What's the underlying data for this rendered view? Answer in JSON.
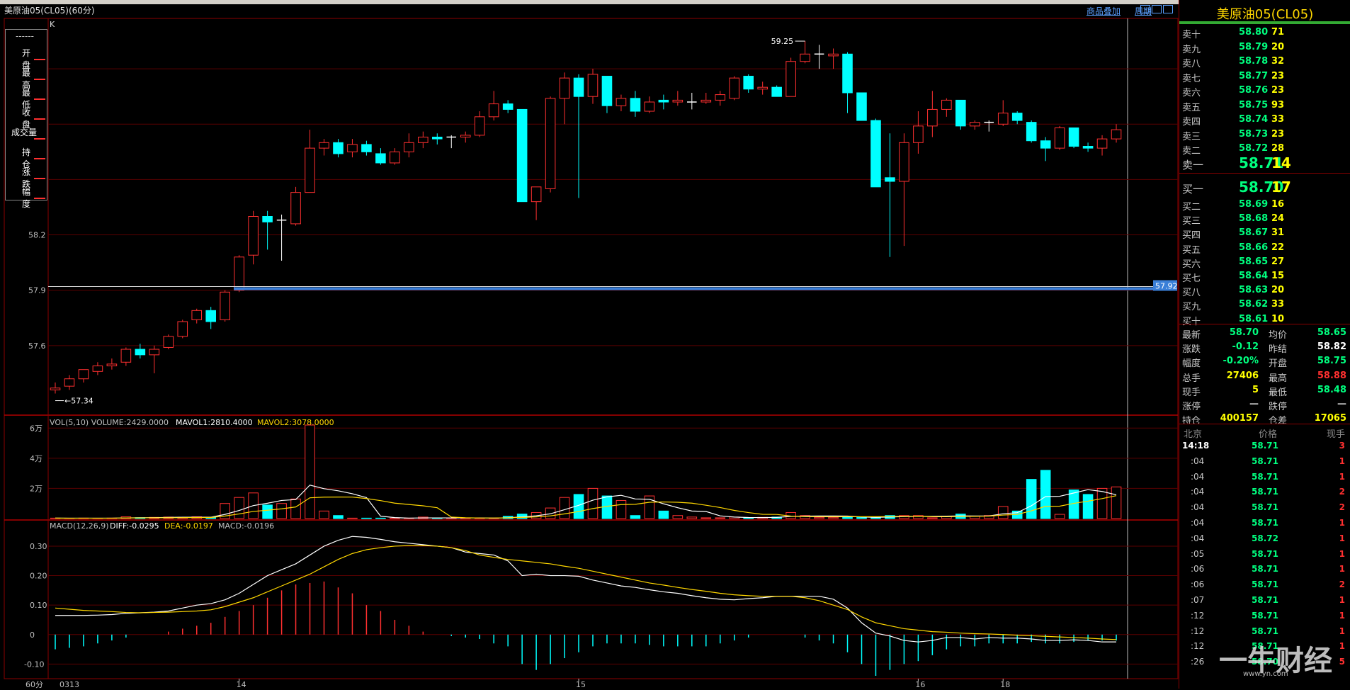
{
  "window": {
    "title": "美原油05(CL05)(60分)",
    "links": [
      "商品叠加",
      "周期"
    ]
  },
  "legend": {
    "header": "------",
    "items": [
      "开 盘",
      "最 高",
      "最 低",
      "收 盘",
      "成交量",
      "持 仓",
      "涨 跌",
      "幅 度"
    ]
  },
  "chart_data": {
    "type": "candlestick",
    "timeframe": "60分",
    "corner_label": "K",
    "price_axis": {
      "ticks": [
        58.2,
        57.9,
        57.6
      ],
      "labels": [
        "58.2",
        "57.9",
        "57.6"
      ],
      "ylim": [
        57.25,
        59.35
      ]
    },
    "high_marker": "59.25",
    "low_marker": "57.34",
    "crosshair_price": "57.92",
    "date_labels": [
      "0313",
      "14",
      "15",
      "16",
      "18"
    ],
    "candles": [
      {
        "o": 57.36,
        "h": 57.4,
        "l": 57.34,
        "c": 57.37
      },
      {
        "o": 57.38,
        "h": 57.44,
        "l": 57.36,
        "c": 57.42
      },
      {
        "o": 57.42,
        "h": 57.47,
        "l": 57.4,
        "c": 57.47
      },
      {
        "o": 57.46,
        "h": 57.51,
        "l": 57.44,
        "c": 57.49
      },
      {
        "o": 57.49,
        "h": 57.53,
        "l": 57.47,
        "c": 57.5
      },
      {
        "o": 57.51,
        "h": 57.59,
        "l": 57.49,
        "c": 57.58
      },
      {
        "o": 57.58,
        "h": 57.61,
        "l": 57.53,
        "c": 57.55
      },
      {
        "o": 57.55,
        "h": 57.6,
        "l": 57.45,
        "c": 57.58
      },
      {
        "o": 57.59,
        "h": 57.66,
        "l": 57.58,
        "c": 57.65
      },
      {
        "o": 57.65,
        "h": 57.74,
        "l": 57.64,
        "c": 57.73
      },
      {
        "o": 57.74,
        "h": 57.8,
        "l": 57.72,
        "c": 57.79
      },
      {
        "o": 57.79,
        "h": 57.81,
        "l": 57.69,
        "c": 57.73
      },
      {
        "o": 57.74,
        "h": 57.9,
        "l": 57.73,
        "c": 57.89
      },
      {
        "o": 57.9,
        "h": 58.09,
        "l": 57.89,
        "c": 58.08
      },
      {
        "o": 58.09,
        "h": 58.33,
        "l": 58.04,
        "c": 58.3
      },
      {
        "o": 58.3,
        "h": 58.33,
        "l": 58.12,
        "c": 58.27
      },
      {
        "o": 58.28,
        "h": 58.31,
        "l": 58.06,
        "c": 58.28
      },
      {
        "o": 58.26,
        "h": 58.46,
        "l": 58.25,
        "c": 58.43
      },
      {
        "o": 58.43,
        "h": 58.77,
        "l": 58.43,
        "c": 58.67
      },
      {
        "o": 58.67,
        "h": 58.72,
        "l": 58.63,
        "c": 58.7
      },
      {
        "o": 58.7,
        "h": 58.72,
        "l": 58.62,
        "c": 58.64
      },
      {
        "o": 58.65,
        "h": 58.72,
        "l": 58.62,
        "c": 58.69
      },
      {
        "o": 58.69,
        "h": 58.71,
        "l": 58.63,
        "c": 58.65
      },
      {
        "o": 58.64,
        "h": 58.67,
        "l": 58.58,
        "c": 58.59
      },
      {
        "o": 58.59,
        "h": 58.67,
        "l": 58.58,
        "c": 58.65
      },
      {
        "o": 58.65,
        "h": 58.75,
        "l": 58.62,
        "c": 58.7
      },
      {
        "o": 58.7,
        "h": 58.76,
        "l": 58.67,
        "c": 58.73
      },
      {
        "o": 58.73,
        "h": 58.75,
        "l": 58.69,
        "c": 58.72
      },
      {
        "o": 58.73,
        "h": 58.74,
        "l": 58.67,
        "c": 58.73
      },
      {
        "o": 58.73,
        "h": 58.76,
        "l": 58.7,
        "c": 58.74
      },
      {
        "o": 58.74,
        "h": 58.87,
        "l": 58.73,
        "c": 58.84
      },
      {
        "o": 58.84,
        "h": 58.98,
        "l": 58.82,
        "c": 58.91
      },
      {
        "o": 58.91,
        "h": 58.93,
        "l": 58.86,
        "c": 58.88
      },
      {
        "o": 58.88,
        "h": 58.88,
        "l": 58.38,
        "c": 58.38
      },
      {
        "o": 58.38,
        "h": 58.44,
        "l": 58.28,
        "c": 58.46
      },
      {
        "o": 58.45,
        "h": 58.95,
        "l": 58.43,
        "c": 58.94
      },
      {
        "o": 58.94,
        "h": 59.08,
        "l": 58.8,
        "c": 59.05
      },
      {
        "o": 59.05,
        "h": 59.07,
        "l": 58.4,
        "c": 58.95
      },
      {
        "o": 58.95,
        "h": 59.1,
        "l": 58.91,
        "c": 59.07
      },
      {
        "o": 59.06,
        "h": 59.06,
        "l": 58.86,
        "c": 58.9
      },
      {
        "o": 58.9,
        "h": 58.96,
        "l": 58.87,
        "c": 58.94
      },
      {
        "o": 58.94,
        "h": 58.98,
        "l": 58.84,
        "c": 58.87
      },
      {
        "o": 58.87,
        "h": 58.95,
        "l": 58.86,
        "c": 58.92
      },
      {
        "o": 58.93,
        "h": 58.96,
        "l": 58.88,
        "c": 58.92
      },
      {
        "o": 58.92,
        "h": 58.98,
        "l": 58.9,
        "c": 58.93
      },
      {
        "o": 58.92,
        "h": 58.97,
        "l": 58.88,
        "c": 58.92
      },
      {
        "o": 58.92,
        "h": 58.97,
        "l": 58.91,
        "c": 58.93
      },
      {
        "o": 58.93,
        "h": 58.98,
        "l": 58.9,
        "c": 58.96
      },
      {
        "o": 58.94,
        "h": 59.06,
        "l": 58.93,
        "c": 59.05
      },
      {
        "o": 59.06,
        "h": 59.07,
        "l": 58.97,
        "c": 58.99
      },
      {
        "o": 58.99,
        "h": 59.03,
        "l": 58.96,
        "c": 59.0
      },
      {
        "o": 59.0,
        "h": 59.01,
        "l": 58.95,
        "c": 58.95
      },
      {
        "o": 58.95,
        "h": 59.16,
        "l": 58.95,
        "c": 59.14
      },
      {
        "o": 59.14,
        "h": 59.25,
        "l": 59.13,
        "c": 59.18
      },
      {
        "o": 59.18,
        "h": 59.23,
        "l": 59.1,
        "c": 59.18
      },
      {
        "o": 59.17,
        "h": 59.21,
        "l": 59.1,
        "c": 59.18
      },
      {
        "o": 59.18,
        "h": 59.19,
        "l": 58.86,
        "c": 58.97
      },
      {
        "o": 58.97,
        "h": 58.97,
        "l": 58.82,
        "c": 58.82
      },
      {
        "o": 58.82,
        "h": 58.83,
        "l": 58.46,
        "c": 58.46
      },
      {
        "o": 58.51,
        "h": 58.75,
        "l": 58.08,
        "c": 58.49
      },
      {
        "o": 58.49,
        "h": 58.75,
        "l": 58.14,
        "c": 58.7
      },
      {
        "o": 58.7,
        "h": 58.87,
        "l": 58.64,
        "c": 58.79
      },
      {
        "o": 58.79,
        "h": 58.98,
        "l": 58.73,
        "c": 58.88
      },
      {
        "o": 58.88,
        "h": 58.94,
        "l": 58.84,
        "c": 58.93
      },
      {
        "o": 58.93,
        "h": 58.93,
        "l": 58.77,
        "c": 58.79
      },
      {
        "o": 58.79,
        "h": 58.82,
        "l": 58.77,
        "c": 58.81
      },
      {
        "o": 58.81,
        "h": 58.82,
        "l": 58.76,
        "c": 58.81
      },
      {
        "o": 58.8,
        "h": 58.93,
        "l": 58.79,
        "c": 58.86
      },
      {
        "o": 58.86,
        "h": 58.87,
        "l": 58.8,
        "c": 58.82
      },
      {
        "o": 58.81,
        "h": 58.82,
        "l": 58.7,
        "c": 58.71
      },
      {
        "o": 58.71,
        "h": 58.73,
        "l": 58.6,
        "c": 58.67
      },
      {
        "o": 58.67,
        "h": 58.79,
        "l": 58.66,
        "c": 58.78
      },
      {
        "o": 58.78,
        "h": 58.78,
        "l": 58.67,
        "c": 58.68
      },
      {
        "o": 58.68,
        "h": 58.7,
        "l": 58.65,
        "c": 58.67
      },
      {
        "o": 58.67,
        "h": 58.74,
        "l": 58.63,
        "c": 58.72
      },
      {
        "o": 58.72,
        "h": 58.8,
        "l": 58.7,
        "c": 58.77
      }
    ],
    "volume": {
      "label": "VOL(5,10) VOLUME:2429.0000",
      "mavol1_label": "MAVOL1:2810.4000",
      "mavol2_label": "MAVOL2:3078.0000",
      "axis_labels": [
        "6万",
        "4万",
        "2万"
      ],
      "ylim": [
        0,
        62000
      ],
      "values": [
        300,
        200,
        300,
        200,
        300,
        1200,
        600,
        800,
        1000,
        800,
        1200,
        800,
        10000,
        14000,
        17000,
        9000,
        10000,
        13000,
        62000,
        5000,
        2000,
        300,
        300,
        300,
        300,
        300,
        1000,
        300,
        300,
        300,
        300,
        300,
        1500,
        3000,
        4000,
        7000,
        14000,
        16000,
        20000,
        15000,
        12000,
        2000,
        15000,
        5000,
        2000,
        1000,
        500,
        500,
        1000,
        500,
        800,
        1000,
        4000,
        2000,
        800,
        800,
        800,
        800,
        800,
        2000,
        2000,
        2000,
        500,
        1500,
        3000,
        1500,
        2000,
        8000,
        5000,
        26000,
        32000,
        2800,
        19000,
        16000,
        20000,
        21000,
        2500,
        2000,
        700,
        2000,
        1200,
        1500,
        2000,
        2000,
        1500,
        1100,
        1800
      ]
    },
    "macd": {
      "label": "MACD(12,26,9)",
      "diff_label": "DIFF:-0.0295",
      "dea_label": "DEA:-0.0197",
      "macd_label": "MACD:-0.0196",
      "axis_labels": [
        "0.30",
        "0.20",
        "0.10",
        "0",
        "-0.10"
      ],
      "ylim": [
        -0.14,
        0.36
      ],
      "diff": [
        0.065,
        0.065,
        0.065,
        0.066,
        0.068,
        0.072,
        0.074,
        0.076,
        0.08,
        0.09,
        0.1,
        0.105,
        0.118,
        0.14,
        0.17,
        0.2,
        0.22,
        0.24,
        0.27,
        0.3,
        0.32,
        0.333,
        0.33,
        0.323,
        0.315,
        0.31,
        0.305,
        0.3,
        0.295,
        0.28,
        0.275,
        0.27,
        0.25,
        0.2,
        0.205,
        0.2,
        0.2,
        0.198,
        0.185,
        0.175,
        0.165,
        0.16,
        0.152,
        0.145,
        0.14,
        0.132,
        0.125,
        0.12,
        0.118,
        0.122,
        0.125,
        0.13,
        0.13,
        0.13,
        0.13,
        0.12,
        0.09,
        0.04,
        0.005,
        -0.005,
        -0.02,
        -0.025,
        -0.02,
        -0.01,
        -0.01,
        -0.015,
        -0.01,
        -0.012,
        -0.012,
        -0.015,
        -0.02,
        -0.02,
        -0.018,
        -0.02,
        -0.025,
        -0.025,
        -0.03,
        -0.03
      ],
      "dea": [
        0.09,
        0.086,
        0.082,
        0.08,
        0.078,
        0.075,
        0.074,
        0.075,
        0.076,
        0.078,
        0.08,
        0.084,
        0.095,
        0.11,
        0.125,
        0.145,
        0.165,
        0.185,
        0.205,
        0.23,
        0.255,
        0.275,
        0.288,
        0.295,
        0.3,
        0.302,
        0.302,
        0.3,
        0.295,
        0.285,
        0.27,
        0.262,
        0.255,
        0.25,
        0.245,
        0.24,
        0.232,
        0.225,
        0.215,
        0.205,
        0.195,
        0.185,
        0.175,
        0.168,
        0.16,
        0.153,
        0.147,
        0.14,
        0.135,
        0.132,
        0.13,
        0.13,
        0.13,
        0.125,
        0.115,
        0.1,
        0.085,
        0.06,
        0.04,
        0.03,
        0.02,
        0.015,
        0.01,
        0.008,
        0.005,
        0.003,
        0.002,
        0.0,
        -0.002,
        -0.004,
        -0.006,
        -0.008,
        -0.01,
        -0.012,
        -0.015,
        -0.017,
        -0.019,
        -0.02
      ],
      "bars": [
        -0.05,
        -0.045,
        -0.04,
        -0.03,
        -0.02,
        -0.01,
        0.0,
        0.0,
        0.01,
        0.02,
        0.03,
        0.04,
        0.06,
        0.08,
        0.1,
        0.125,
        0.15,
        0.17,
        0.175,
        0.18,
        0.16,
        0.14,
        0.1,
        0.08,
        0.05,
        0.03,
        0.01,
        0.0,
        -0.005,
        -0.01,
        -0.015,
        -0.03,
        -0.04,
        -0.1,
        -0.12,
        -0.1,
        -0.08,
        -0.06,
        -0.04,
        -0.03,
        -0.03,
        -0.03,
        -0.035,
        -0.04,
        -0.04,
        -0.04,
        -0.04,
        -0.03,
        -0.02,
        -0.01,
        0.0,
        0.0,
        0.0,
        -0.01,
        -0.02,
        -0.03,
        -0.06,
        -0.1,
        -0.14,
        -0.12,
        -0.1,
        -0.09,
        -0.07,
        -0.05,
        -0.04,
        -0.04,
        -0.03,
        -0.03,
        -0.03,
        -0.025,
        -0.03,
        -0.03,
        -0.025,
        -0.02,
        -0.02,
        -0.02,
        -0.02,
        -0.02
      ]
    }
  },
  "panel": {
    "title": "美原油05(CL05)",
    "asks": [
      {
        "label": "卖十",
        "price": "58.80",
        "vol": "71"
      },
      {
        "label": "卖九",
        "price": "58.79",
        "vol": "20"
      },
      {
        "label": "卖八",
        "price": "58.78",
        "vol": "32"
      },
      {
        "label": "卖七",
        "price": "58.77",
        "vol": "23"
      },
      {
        "label": "卖六",
        "price": "58.76",
        "vol": "23"
      },
      {
        "label": "卖五",
        "price": "58.75",
        "vol": "93"
      },
      {
        "label": "卖四",
        "price": "58.74",
        "vol": "33"
      },
      {
        "label": "卖三",
        "price": "58.73",
        "vol": "23"
      },
      {
        "label": "卖二",
        "price": "58.72",
        "vol": "28"
      },
      {
        "label": "卖一",
        "price": "58.71",
        "vol": "14"
      }
    ],
    "bids": [
      {
        "label": "买一",
        "price": "58.70",
        "vol": "17"
      },
      {
        "label": "买二",
        "price": "58.69",
        "vol": "16"
      },
      {
        "label": "买三",
        "price": "58.68",
        "vol": "24"
      },
      {
        "label": "买四",
        "price": "58.67",
        "vol": "31"
      },
      {
        "label": "买五",
        "price": "58.66",
        "vol": "22"
      },
      {
        "label": "买六",
        "price": "58.65",
        "vol": "27"
      },
      {
        "label": "买七",
        "price": "58.64",
        "vol": "15"
      },
      {
        "label": "买八",
        "price": "58.63",
        "vol": "20"
      },
      {
        "label": "买九",
        "price": "58.62",
        "vol": "33"
      },
      {
        "label": "买十",
        "price": "58.61",
        "vol": "10"
      }
    ],
    "stats": [
      {
        "l1": "最新",
        "v1": "58.70",
        "c1": "#00ff7f",
        "l2": "均价",
        "v2": "58.65",
        "c2": "#00ff7f"
      },
      {
        "l1": "涨跌",
        "v1": "-0.12",
        "c1": "#00ff7f",
        "l2": "昨结",
        "v2": "58.82",
        "c2": "#ffffff"
      },
      {
        "l1": "幅度",
        "v1": "-0.20%",
        "c1": "#00ff7f",
        "l2": "开盘",
        "v2": "58.75",
        "c2": "#00ff7f"
      },
      {
        "l1": "总手",
        "v1": "27406",
        "c1": "#ffff00",
        "l2": "最高",
        "v2": "58.88",
        "c2": "#ff3030"
      },
      {
        "l1": "现手",
        "v1": "5",
        "c1": "#ffff00",
        "l2": "最低",
        "v2": "58.48",
        "c2": "#00ff7f"
      },
      {
        "l1": "涨停",
        "v1": "—",
        "c1": "#c8c8c8",
        "l2": "跌停",
        "v2": "—",
        "c2": "#c8c8c8"
      },
      {
        "l1": "持仓",
        "v1": "400157",
        "c1": "#ffff00",
        "l2": "仓差",
        "v2": "17065",
        "c2": "#ffff00"
      }
    ],
    "ticks_header": {
      "time": "北京",
      "price": "价格",
      "vol": "现手"
    },
    "ticks": [
      {
        "t": "14:18",
        "p": "58.71",
        "v": "3"
      },
      {
        "t": ":04",
        "p": "58.71",
        "v": "1"
      },
      {
        "t": ":04",
        "p": "58.71",
        "v": "1"
      },
      {
        "t": ":04",
        "p": "58.71",
        "v": "2"
      },
      {
        "t": ":04",
        "p": "58.71",
        "v": "2"
      },
      {
        "t": ":04",
        "p": "58.71",
        "v": "1"
      },
      {
        "t": ":04",
        "p": "58.72",
        "v": "1"
      },
      {
        "t": ":05",
        "p": "58.71",
        "v": "1"
      },
      {
        "t": ":06",
        "p": "58.71",
        "v": "1"
      },
      {
        "t": ":06",
        "p": "58.71",
        "v": "2"
      },
      {
        "t": ":07",
        "p": "58.71",
        "v": "1"
      },
      {
        "t": ":12",
        "p": "58.71",
        "v": "1"
      },
      {
        "t": ":12",
        "p": "58.71",
        "v": "1"
      },
      {
        "t": ":12",
        "p": "58.71",
        "v": "1"
      },
      {
        "t": ":26",
        "p": "58.70",
        "v": "5"
      }
    ]
  },
  "watermark": {
    "brand": "一牛财经",
    "url": "www.yn.com"
  }
}
